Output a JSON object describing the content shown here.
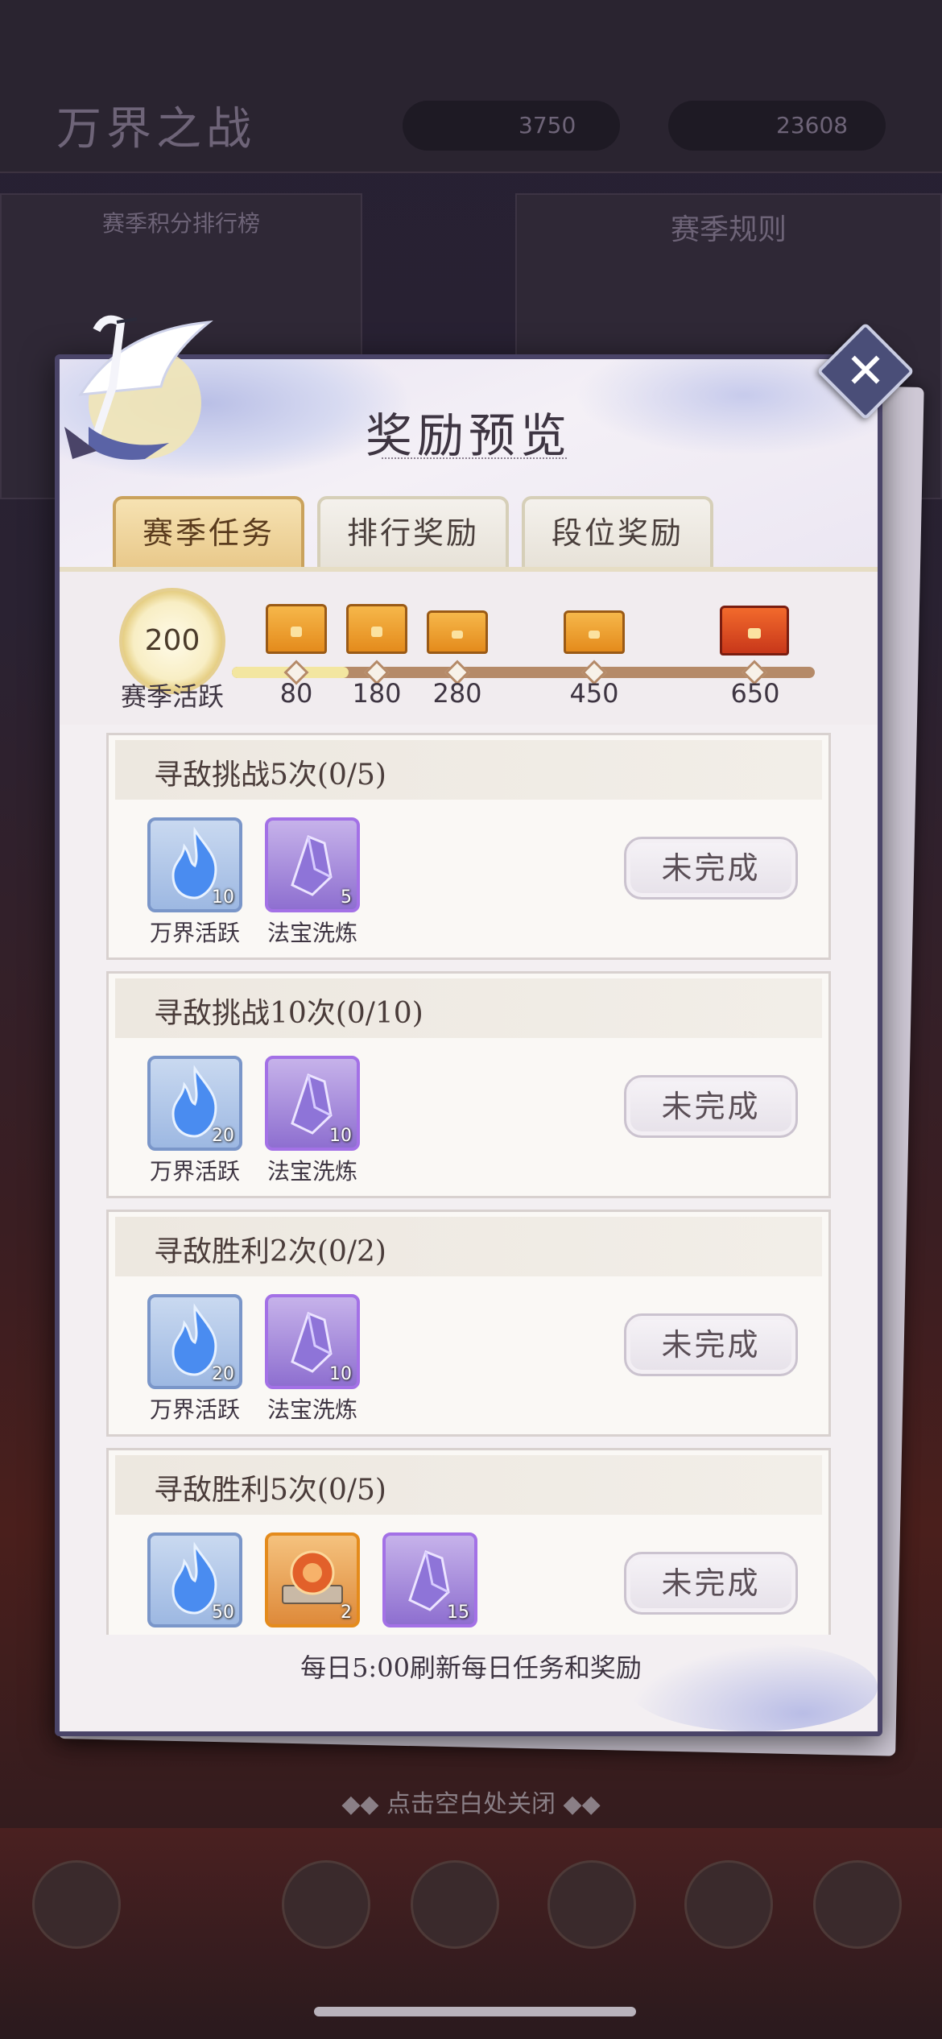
{
  "background": {
    "title": "万界之战",
    "resources": [
      "3750",
      "23608"
    ],
    "left_panel_title": "赛季积分排行榜",
    "right_panel_title": "赛季规则",
    "close_hint": "点击空白处关闭"
  },
  "modal": {
    "title": "奖励预览",
    "tabs": [
      {
        "label": "赛季任务",
        "active": true
      },
      {
        "label": "排行奖励",
        "active": false
      },
      {
        "label": "段位奖励",
        "active": false
      }
    ],
    "progress": {
      "current": "200",
      "label": "赛季活跃",
      "fraction": 0.2,
      "milestones": [
        "80",
        "180",
        "280",
        "450",
        "650"
      ]
    },
    "tasks": [
      {
        "title": "寻敌挑战5次(0/5)",
        "status": "未完成",
        "rewards": [
          {
            "name": "万界活跃",
            "count": "10",
            "icon": "blue-flame-icon"
          },
          {
            "name": "法宝洗炼",
            "count": "5",
            "icon": "purple-crystal-icon"
          }
        ]
      },
      {
        "title": "寻敌挑战10次(0/10)",
        "status": "未完成",
        "rewards": [
          {
            "name": "万界活跃",
            "count": "20",
            "icon": "blue-flame-icon"
          },
          {
            "name": "法宝洗炼",
            "count": "10",
            "icon": "purple-crystal-icon"
          }
        ]
      },
      {
        "title": "寻敌胜利2次(0/2)",
        "status": "未完成",
        "rewards": [
          {
            "name": "万界活跃",
            "count": "20",
            "icon": "blue-flame-icon"
          },
          {
            "name": "法宝洗炼",
            "count": "10",
            "icon": "purple-crystal-icon"
          }
        ]
      },
      {
        "title": "寻敌胜利5次(0/5)",
        "status": "未完成",
        "rewards": [
          {
            "count": "50",
            "icon": "blue-flame-icon"
          },
          {
            "count": "2",
            "icon": "orange-seal-icon"
          },
          {
            "count": "15",
            "icon": "purple-crystal-icon"
          }
        ]
      }
    ],
    "footer_note": "每日5:00刷新每日任务和奖励"
  },
  "colors": {
    "tab_active": "#e9c98b",
    "progress_fill": "#f3e6a0",
    "progress_track": "#b58a68",
    "modal_border": "#4a4468"
  }
}
